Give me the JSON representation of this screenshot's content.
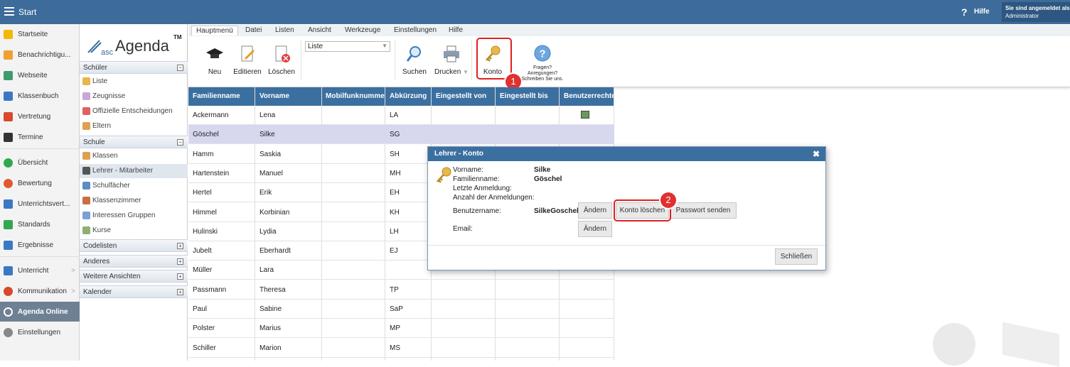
{
  "topbar": {
    "title": "Start",
    "help": "Hilfe",
    "user_line1": "Sie sind angemeldet als",
    "user_line2": "Administrator"
  },
  "nav": [
    {
      "label": "Startseite",
      "color": "#f2b807"
    },
    {
      "label": "Benachrichtigu...",
      "color": "#f0a030"
    },
    {
      "label": "Webseite",
      "color": "#3f9b6b"
    },
    {
      "label": "Klassenbuch",
      "color": "#3b78c4"
    },
    {
      "label": "Vertretung",
      "color": "#d9482a"
    },
    {
      "label": "Termine",
      "color": "#333333"
    },
    {
      "label": "Übersicht",
      "color": "#2fa84f"
    },
    {
      "label": "Bewertung",
      "color": "#e25a30"
    },
    {
      "label": "Unterrichtsvert...",
      "color": "#3b78c4"
    },
    {
      "label": "Standards",
      "color": "#2fa84f"
    },
    {
      "label": "Ergebnisse",
      "color": "#3b78c4"
    },
    {
      "label": "Unterricht",
      "color": "#3b78c4"
    },
    {
      "label": "Kommunikation",
      "color": "#d9482a"
    },
    {
      "label": "Agenda Online",
      "color": "#ffffff"
    },
    {
      "label": "Einstellungen",
      "color": "#888888"
    }
  ],
  "logo": {
    "asc": "asc",
    "agenda": "Agenda",
    "tm": "TM"
  },
  "side": {
    "schueler": "Schüler",
    "schueler_items": [
      "Liste",
      "Zeugnisse",
      "Offizielle Entscheidungen",
      "Eltern"
    ],
    "schule": "Schule",
    "schule_items": [
      "Klassen",
      "Lehrer - Mitarbeiter",
      "Schulfächer",
      "Klassenzimmer",
      "Interessen Gruppen",
      "Kurse"
    ],
    "codelisten": "Codelisten",
    "anderes": "Anderes",
    "weitere": "Weitere Ansichten",
    "kalender": "Kalender"
  },
  "tabs": [
    "Hauptmenü",
    "Datei",
    "Listen",
    "Ansicht",
    "Werkzeuge",
    "Einstellungen",
    "Hilfe"
  ],
  "ribbon": {
    "neu": "Neu",
    "editieren": "Editieren",
    "loeschen": "Löschen",
    "combo": "Liste",
    "suchen": "Suchen",
    "drucken": "Drucken",
    "konto": "Konto",
    "fragen1": "Fragen?",
    "fragen2": "Anregungen?",
    "fragen3": "Schreiben Sie uns."
  },
  "badges": {
    "b1": "1",
    "b2": "2"
  },
  "grid": {
    "headers": [
      "Familienname",
      "Vorname",
      "Mobilfunknummer",
      "Abkürzung",
      "Eingestellt von",
      "Eingestellt bis",
      "Benutzerrechte"
    ],
    "rows": [
      [
        "Ackermann",
        "Lena",
        "LA"
      ],
      [
        "Göschel",
        "Silke",
        "SG"
      ],
      [
        "Hamm",
        "Saskia",
        "SH"
      ],
      [
        "Hartenstein",
        "Manuel",
        "MH"
      ],
      [
        "Hertel",
        "Erik",
        "EH"
      ],
      [
        "Himmel",
        "Korbinian",
        "KH"
      ],
      [
        "Hulinski",
        "Lydia",
        "LH"
      ],
      [
        "Jubelt",
        "Eberhardt",
        "EJ"
      ],
      [
        "Müller",
        "Lara",
        ""
      ],
      [
        "Passmann",
        "Theresa",
        "TP"
      ],
      [
        "Paul",
        "Sabine",
        "SaP"
      ],
      [
        "Polster",
        "Marius",
        "MP"
      ],
      [
        "Schiller",
        "Marion",
        "MS"
      ]
    ]
  },
  "dialog": {
    "title": "Lehrer - Konto",
    "vorname_label": "Vorname:",
    "vorname": "Silke",
    "familienname_label": "Familienname:",
    "familienname": "Göschel",
    "letzte_label": "Letzte Anmeldung:",
    "anzahl_label": "Anzahl der Anmeldungen:",
    "benutzer_label": "Benutzername:",
    "benutzer": "SilkeGoschel",
    "aendern": "Ändern",
    "konto_loeschen": "Konto löschen",
    "passwort": "Passwort senden",
    "email_label": "Email:",
    "aendern2": "Ändern",
    "schliessen": "Schließen"
  }
}
